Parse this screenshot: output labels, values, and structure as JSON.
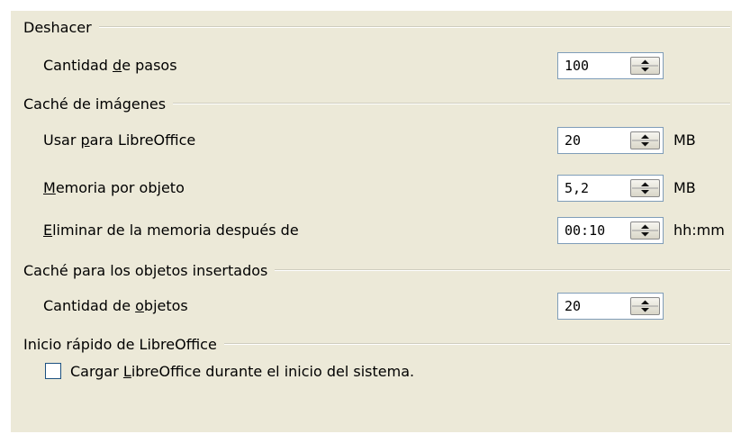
{
  "sections": {
    "undo": {
      "title": "Deshacer",
      "steps": {
        "label_pre": "Cantidad ",
        "label_key": "d",
        "label_post": "e pasos",
        "value": "100"
      }
    },
    "image_cache": {
      "title": "Caché de imágenes",
      "use_for": {
        "label_pre": "Usar ",
        "label_key": "p",
        "label_post": "ara LibreOffice",
        "value": "20",
        "unit": "MB"
      },
      "per_object": {
        "label_pre": "",
        "label_key": "M",
        "label_post": "emoria por objeto",
        "value": "5,2",
        "unit": "MB"
      },
      "remove_after": {
        "label_pre": "",
        "label_key": "E",
        "label_post": "liminar de la memoria después de",
        "value": "00:10",
        "unit": "hh:mm"
      }
    },
    "object_cache": {
      "title": "Caché para los objetos insertados",
      "count": {
        "label_pre": "Cantidad de ",
        "label_key": "o",
        "label_post": "bjetos",
        "value": "20"
      }
    },
    "quickstart": {
      "title": "Inicio rápido de LibreOffice",
      "load": {
        "label_pre": "Cargar ",
        "label_key": "L",
        "label_post": "ibreOffice durante el inicio del sistema.",
        "checked": false
      }
    }
  },
  "icons": {
    "spin": "spin-up-down-icon"
  }
}
